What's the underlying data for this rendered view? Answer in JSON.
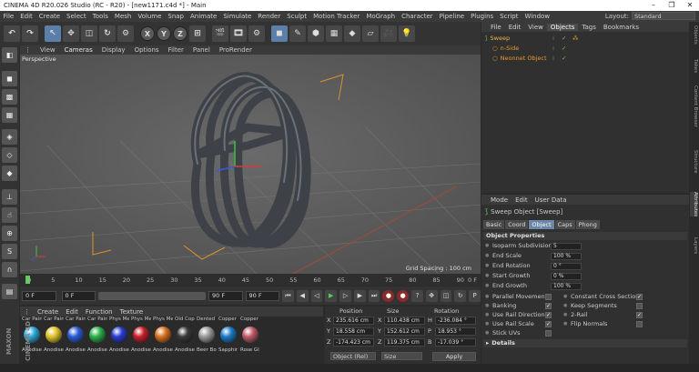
{
  "window": {
    "title": "CINEMA 4D R20.026 Studio (RC - R20) - [new1171.c4d *] - Main",
    "controls": [
      "–",
      "❐",
      "✕"
    ]
  },
  "menubar": {
    "items": [
      "File",
      "Edit",
      "Create",
      "Select",
      "Tools",
      "Mesh",
      "Volume",
      "Snap",
      "Animate",
      "Simulate",
      "Render",
      "Sculpt",
      "Motion Tracker",
      "MoGraph",
      "Character",
      "Pipeline",
      "Plugins",
      "Script",
      "Window"
    ],
    "layout_label": "Layout:",
    "layout_value": "Standard"
  },
  "toolbar": {
    "axis_buttons": [
      "X",
      "Y",
      "Z"
    ]
  },
  "viewport": {
    "menu": [
      "View",
      "Cameras",
      "Display",
      "Options",
      "Filter",
      "Panel",
      "ProRender"
    ],
    "label": "Perspective",
    "grid_spacing": "Grid Spacing : 100 cm"
  },
  "timeline": {
    "ticks": [
      "0",
      "5",
      "10",
      "15",
      "20",
      "25",
      "30",
      "35",
      "40",
      "45",
      "50",
      "55",
      "60",
      "65",
      "70",
      "75",
      "80",
      "85",
      "90"
    ],
    "end_mark": "0 F"
  },
  "playback": {
    "start_frame": "0 F",
    "current_frame": "0 F",
    "end_frame_a": "90 F",
    "end_frame_b": "90 F"
  },
  "material_manager": {
    "menu": [
      "Create",
      "Edit",
      "Function",
      "Texture"
    ],
    "materials": [
      {
        "top": "Car Pain",
        "bottom": "Anodise",
        "color": "#2aa9d8"
      },
      {
        "top": "Car Pain",
        "bottom": "Anodise",
        "color": "#e0c22a"
      },
      {
        "top": "Car Pain",
        "bottom": "Anodise",
        "color": "#2a5ad8"
      },
      {
        "top": "Car Pain",
        "bottom": "Anodise",
        "color": "#2ab04a"
      },
      {
        "top": "Phys Me",
        "bottom": "Anodise",
        "color": "#2a3ad0"
      },
      {
        "top": "Phys Me",
        "bottom": "Anodise",
        "color": "#c81e2a"
      },
      {
        "top": "Phys Me",
        "bottom": "Anodise",
        "color": "#d8701e"
      },
      {
        "top": "Old Cop",
        "bottom": "Anodise",
        "color": "#3a3a3a"
      },
      {
        "top": "Dented",
        "bottom": "Beer Bo",
        "color": "#9a9a9a"
      },
      {
        "top": "Copper",
        "bottom": "Sapphir",
        "color": "#1a7ac8"
      },
      {
        "top": "Copper",
        "bottom": "Rose Gl",
        "color": "#c05a6a"
      }
    ]
  },
  "coordinates": {
    "headers": [
      "Position",
      "Size",
      "Rotation"
    ],
    "rows": [
      {
        "axis": "X",
        "pos": "235.616 cm",
        "size_axis": "X",
        "size": "110.438 cm",
        "rot_axis": "H",
        "rot": "-236.084 °"
      },
      {
        "axis": "Y",
        "pos": "18.558 cm",
        "size_axis": "Y",
        "size": "152.612 cm",
        "rot_axis": "P",
        "rot": "18.953 °"
      },
      {
        "axis": "Z",
        "pos": "-174.423 cm",
        "size_axis": "Z",
        "size": "119.375 cm",
        "rot_axis": "B",
        "rot": "-17.039 °"
      }
    ],
    "mode_select": "Object (Rel)",
    "size_select": "Size",
    "apply_label": "Apply"
  },
  "object_manager": {
    "menu": [
      "File",
      "Edit",
      "View",
      "Objects",
      "Tags",
      "Bookmarks"
    ],
    "active_menu": "Objects",
    "objects": [
      {
        "name": "Sweep",
        "color": "#e8b84a",
        "indent": 0
      },
      {
        "name": "n-Side",
        "color": "#e89a2a",
        "indent": 1
      },
      {
        "name": "Neonnet Object",
        "color": "#e89a2a",
        "indent": 1
      }
    ]
  },
  "attributes": {
    "menu": [
      "Mode",
      "Edit",
      "User Data"
    ],
    "object_title": "Sweep Object [Sweep]",
    "tabs": [
      "Basic",
      "Coord",
      "Object",
      "Caps",
      "Phong"
    ],
    "active_tab": "Object",
    "section_title": "Object Properties",
    "props": [
      {
        "label": "Isoparm Subdivision",
        "value": "5"
      },
      {
        "label": "End Scale",
        "value": "100 %"
      },
      {
        "label": "End Rotation",
        "value": "0 °"
      },
      {
        "label": "Start Growth",
        "value": "0 %"
      },
      {
        "label": "End Growth",
        "value": "100 %"
      }
    ],
    "checks_left": [
      {
        "label": "Parallel Movement",
        "checked": false
      },
      {
        "label": "Banking",
        "checked": true
      },
      {
        "label": "Use Rail Direction",
        "checked": true
      },
      {
        "label": "Use Rail Scale",
        "checked": true
      },
      {
        "label": "Stick UVs",
        "checked": false
      }
    ],
    "checks_right": [
      {
        "label": "Constant Cross Section",
        "checked": true
      },
      {
        "label": "Keep Segments",
        "checked": false
      },
      {
        "label": "2-Rail",
        "checked": true
      },
      {
        "label": "Flip Normals",
        "checked": false
      }
    ],
    "details_label": "Details"
  },
  "right_tabs": [
    "Objects",
    "Takes",
    "Content Browser",
    "Structure",
    "Attributes",
    "Layers"
  ],
  "brand": "MAXON CINEMA 4D"
}
